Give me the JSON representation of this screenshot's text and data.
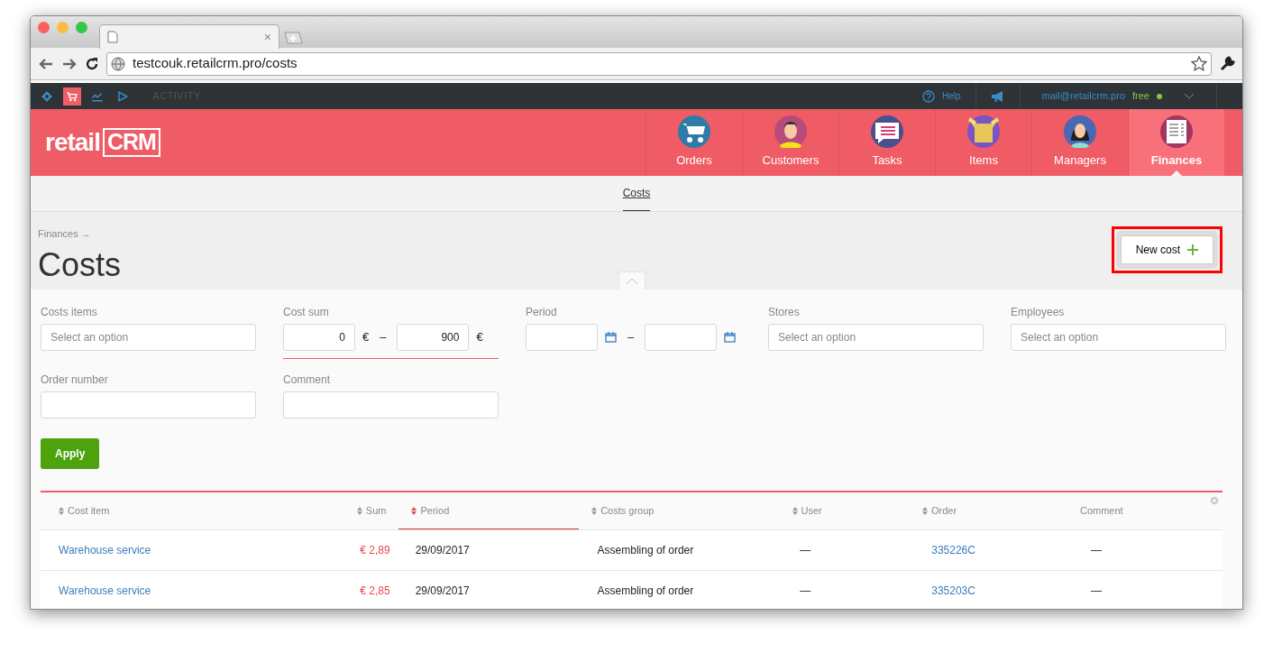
{
  "browser": {
    "tab_close": "×",
    "url": "testcouk.retailcrm.pro/costs"
  },
  "topbar": {
    "apps": [
      {
        "selected": false
      },
      {
        "selected": true
      },
      {
        "selected": false
      },
      {
        "selected": false
      }
    ],
    "activity": "ACTIVITY",
    "help": "Help",
    "email": "mail@retailcrm.pro",
    "plan": "free"
  },
  "logo": {
    "text": "retail",
    "accent": "CRM"
  },
  "nav": [
    {
      "label": "Orders",
      "selected": false
    },
    {
      "label": "Customers",
      "selected": false
    },
    {
      "label": "Tasks",
      "selected": false
    },
    {
      "label": "Items",
      "selected": false
    },
    {
      "label": "Managers",
      "selected": false
    },
    {
      "label": "Finances",
      "selected": true
    }
  ],
  "subnav": [
    {
      "label": "Costs",
      "selected": true
    }
  ],
  "breadcrumb": "Finances →",
  "title": "Costs",
  "new_button": {
    "label": "New cost",
    "highlighted": true
  },
  "filters": [
    {
      "kind": "select",
      "label": "Costs items",
      "placeholder": "Select an option"
    },
    {
      "kind": "range",
      "label": "Cost sum",
      "from": "0",
      "to": "900",
      "unit": "€",
      "dash": "–"
    },
    {
      "kind": "dates",
      "label": "Period",
      "dash": "–"
    },
    {
      "kind": "select",
      "label": "Stores",
      "placeholder": "Select an option"
    },
    {
      "kind": "select",
      "label": "Employees",
      "placeholder": "Select an option"
    },
    {
      "kind": "text",
      "label": "Order number"
    },
    {
      "kind": "text",
      "label": "Comment"
    }
  ],
  "apply": "Apply",
  "table": {
    "columns": [
      {
        "label": "Cost item",
        "sortable": true,
        "sorted": false
      },
      {
        "label": "Sum",
        "sortable": true,
        "sorted": false
      },
      {
        "label": "Period",
        "sortable": true,
        "sorted": true
      },
      {
        "label": "Costs group",
        "sortable": true,
        "sorted": false
      },
      {
        "label": "User",
        "sortable": true,
        "sorted": false
      },
      {
        "label": "Order",
        "sortable": true,
        "sorted": false
      },
      {
        "label": "Comment",
        "sortable": false,
        "sorted": false
      }
    ],
    "rows": [
      [
        {
          "kind": "link",
          "text": "Warehouse service"
        },
        {
          "kind": "sum",
          "text": "€ 2,89"
        },
        {
          "kind": "text",
          "text": "29/09/2017"
        },
        {
          "kind": "text",
          "text": "Assembling of order"
        },
        {
          "kind": "text",
          "text": "—"
        },
        {
          "kind": "link",
          "text": "335226C"
        },
        {
          "kind": "text",
          "text": "—"
        }
      ],
      [
        {
          "kind": "link",
          "text": "Warehouse service"
        },
        {
          "kind": "sum",
          "text": "€ 2,85"
        },
        {
          "kind": "text",
          "text": "29/09/2017"
        },
        {
          "kind": "text",
          "text": "Assembling of order"
        },
        {
          "kind": "text",
          "text": "—"
        },
        {
          "kind": "link",
          "text": "335203C"
        },
        {
          "kind": "text",
          "text": "—"
        }
      ]
    ]
  }
}
